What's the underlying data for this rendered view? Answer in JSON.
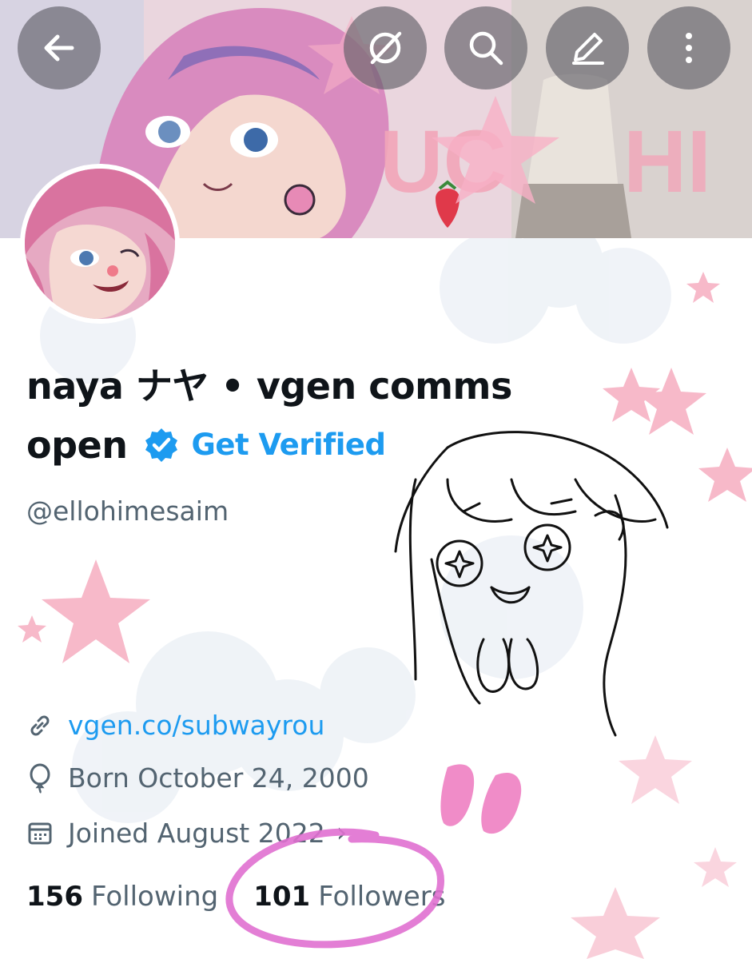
{
  "banner": {
    "back_icon": "arrow-left-icon",
    "grok_icon": "grok-icon",
    "search_icon": "search-icon",
    "edit_icon": "pencil-icon",
    "more_icon": "more-vertical-icon",
    "art_text": "UCHI"
  },
  "profile": {
    "name_line1": "naya ナヤ • vgen comms",
    "name_line2": "open",
    "verified_icon": "verified-badge-icon",
    "verified_color": "#1d9bf0",
    "get_verified": "Get Verified",
    "handle": "@ellohimesaim",
    "link": "vgen.co/subwayrou",
    "born": "Born October 24, 2000",
    "joined": "Joined August 2022",
    "joined_chevron": "›",
    "following_count": "156",
    "following_label": "Following",
    "followers_count": "101",
    "followers_label": "Followers"
  },
  "colors": {
    "accent": "#1d9bf0",
    "text_primary": "#0f1419",
    "text_secondary": "#536471",
    "highlight_circle": "#e070d0",
    "star_pink": "#f6b8c8"
  }
}
